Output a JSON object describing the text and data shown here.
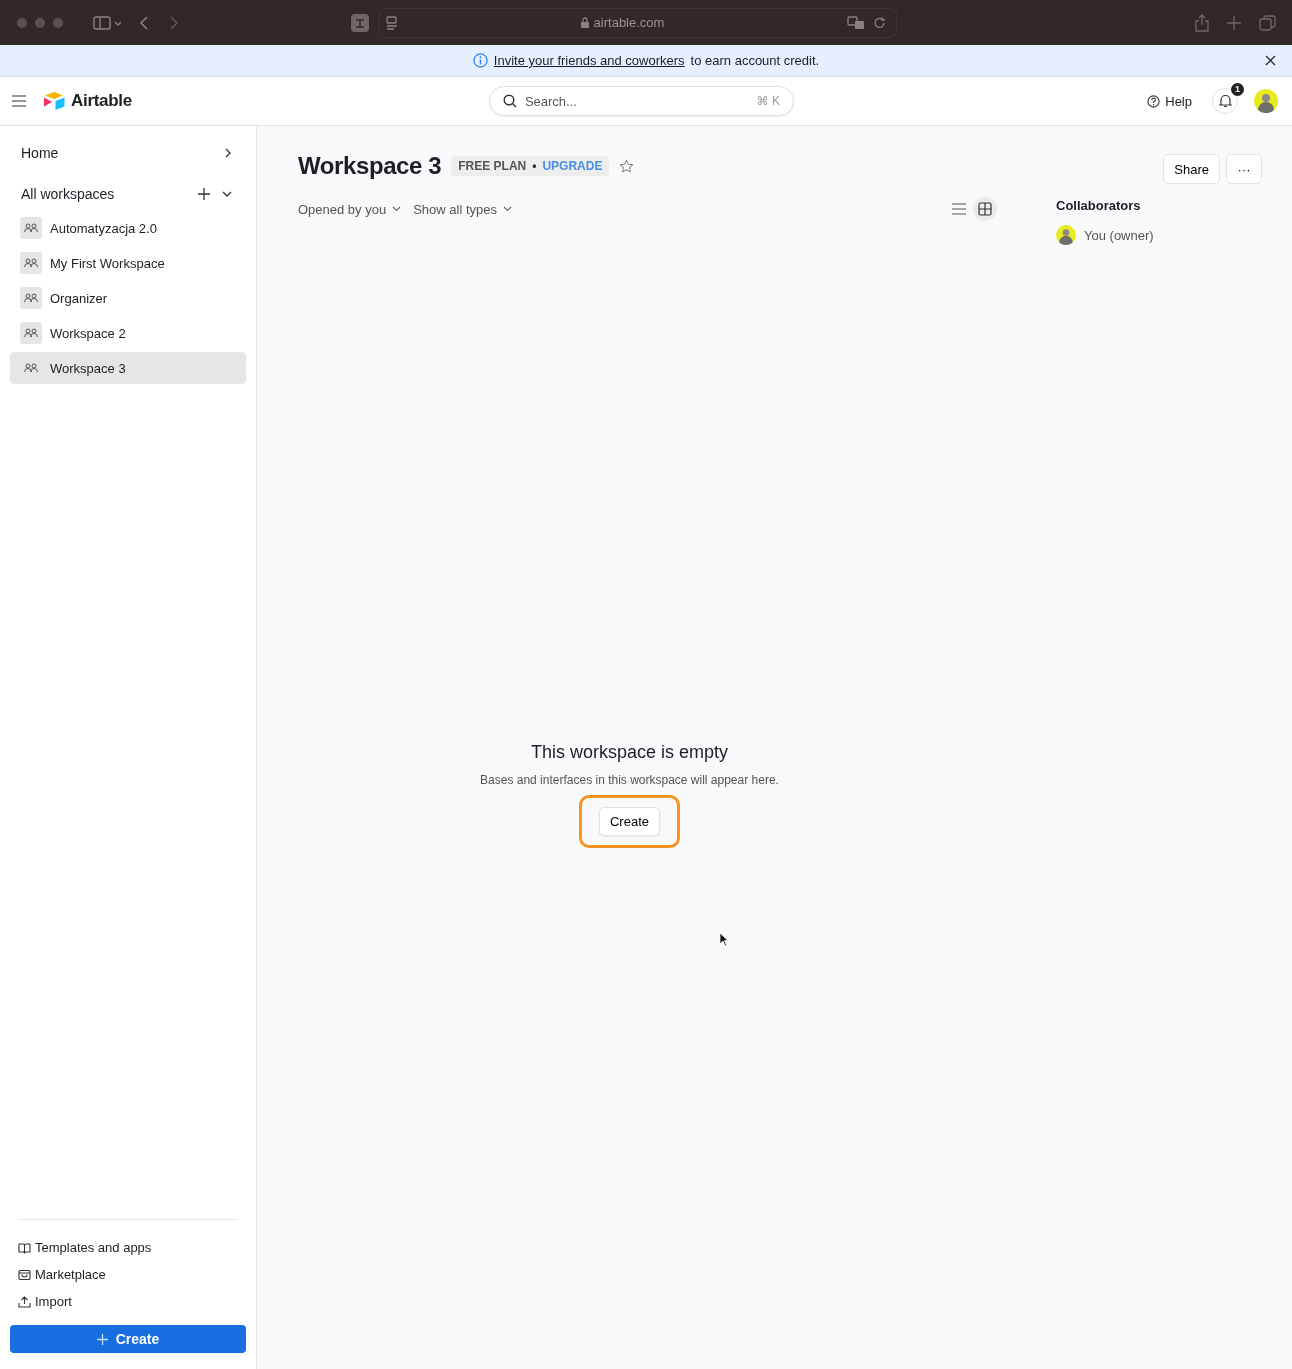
{
  "browser": {
    "url": "airtable.com"
  },
  "banner": {
    "link": "Invite your friends and coworkers",
    "text": "to earn account credit."
  },
  "header": {
    "logo": "Airtable",
    "search": {
      "placeholder": "Search...",
      "shortcut": "⌘ K"
    },
    "help": "Help",
    "notifications": "1"
  },
  "sidebar": {
    "home": "Home",
    "section": "All workspaces",
    "items": [
      {
        "label": "Automatyzacja 2.0",
        "selected": false
      },
      {
        "label": "My First Workspace",
        "selected": false
      },
      {
        "label": "Organizer",
        "selected": false
      },
      {
        "label": "Workspace 2",
        "selected": false
      },
      {
        "label": "Workspace 3",
        "selected": true
      }
    ],
    "links": [
      {
        "kind": "book",
        "label": "Templates and apps"
      },
      {
        "kind": "store",
        "label": "Marketplace"
      },
      {
        "kind": "upload",
        "label": "Import"
      }
    ],
    "create": "Create"
  },
  "main": {
    "title": "Workspace 3",
    "plan": "FREE PLAN",
    "separator": "•",
    "upgrade": "UPGRADE",
    "share": "Share",
    "more": "···",
    "filters": [
      "Opened by you",
      "Show all types"
    ],
    "views": [
      {
        "kind": "list",
        "selected": false
      },
      {
        "kind": "grid",
        "selected": true
      }
    ],
    "empty": {
      "title": "This workspace is empty",
      "text": "Bases and interfaces in this workspace will appear here.",
      "button": "Create",
      "highlighted": true
    }
  },
  "collaborators": {
    "title": "Collaborators",
    "people": [
      {
        "name": "You (owner)"
      }
    ]
  }
}
